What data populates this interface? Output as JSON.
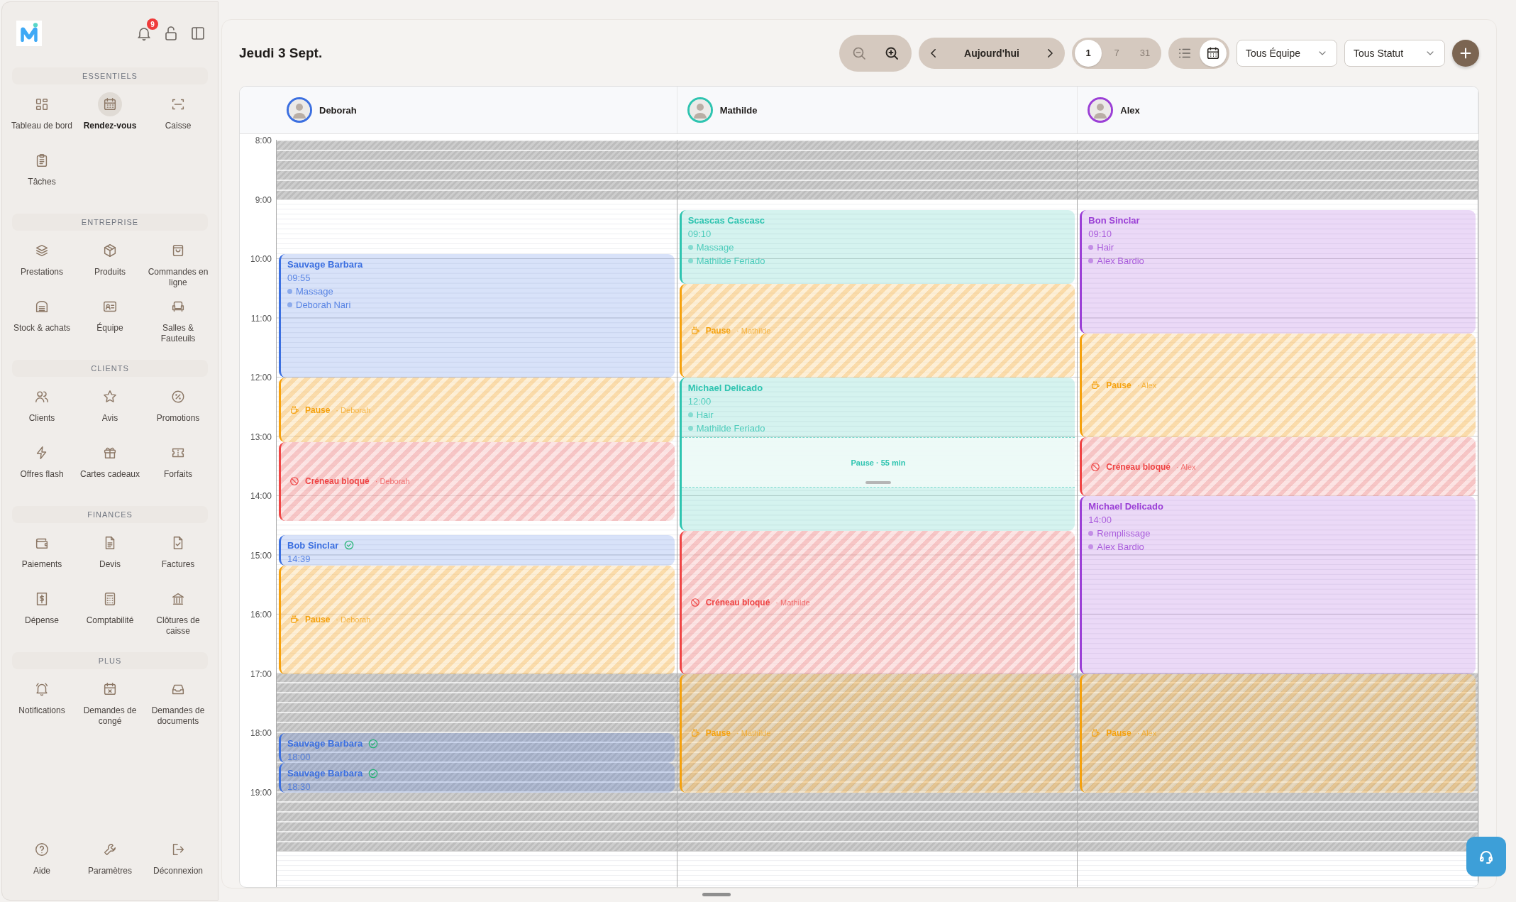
{
  "sidebar": {
    "notification_count": "9",
    "sections": [
      {
        "title": "ESSENTIELS",
        "items": [
          {
            "label": "Tableau de bord",
            "selected": false
          },
          {
            "label": "Rendez-vous",
            "selected": true
          },
          {
            "label": "Caisse",
            "selected": false
          },
          {
            "label": "Tâches",
            "selected": false
          }
        ]
      },
      {
        "title": "ENTREPRISE",
        "items": [
          {
            "label": "Prestations",
            "selected": false
          },
          {
            "label": "Produits",
            "selected": false
          },
          {
            "label": "Commandes en ligne",
            "selected": false
          },
          {
            "label": "Stock & achats",
            "selected": false
          },
          {
            "label": "Équipe",
            "selected": false
          },
          {
            "label": "Salles & Fauteuils",
            "selected": false
          }
        ]
      },
      {
        "title": "CLIENTS",
        "items": [
          {
            "label": "Clients",
            "selected": false
          },
          {
            "label": "Avis",
            "selected": false
          },
          {
            "label": "Promotions",
            "selected": false
          },
          {
            "label": "Offres flash",
            "selected": false
          },
          {
            "label": "Cartes cadeaux",
            "selected": false
          },
          {
            "label": "Forfaits",
            "selected": false
          }
        ]
      },
      {
        "title": "FINANCES",
        "items": [
          {
            "label": "Paiements",
            "selected": false
          },
          {
            "label": "Devis",
            "selected": false
          },
          {
            "label": "Factures",
            "selected": false
          },
          {
            "label": "Dépense",
            "selected": false
          },
          {
            "label": "Comptabilité",
            "selected": false
          },
          {
            "label": "Clôtures de caisse",
            "selected": false
          }
        ]
      },
      {
        "title": "PLUS",
        "items": [
          {
            "label": "Notifications",
            "selected": false
          },
          {
            "label": "Demandes de congé",
            "selected": false
          },
          {
            "label": "Demandes de documents",
            "selected": false
          }
        ]
      }
    ],
    "footer": [
      {
        "label": "Aide"
      },
      {
        "label": "Paramètres"
      },
      {
        "label": "Déconnexion"
      }
    ]
  },
  "header": {
    "title": "Jeudi 3 Sept.",
    "today": "Aujourd'hui",
    "views": [
      {
        "label": "1",
        "selected": true
      },
      {
        "label": "7",
        "selected": false
      },
      {
        "label": "31",
        "selected": false
      }
    ],
    "display_modes": [
      {
        "selected": false
      },
      {
        "selected": true
      }
    ],
    "filters": [
      {
        "value": "Tous Équipe"
      },
      {
        "value": "Tous Statut"
      }
    ]
  },
  "calendar": {
    "hours": [
      "8:00",
      "9:00",
      "10:00",
      "11:00",
      "12:00",
      "13:00",
      "14:00",
      "15:00",
      "16:00",
      "17:00",
      "18:00",
      "19:00"
    ],
    "staff": [
      {
        "name": "Deborah",
        "color": "#3b6fe0",
        "events": [
          {
            "kind": "appointment",
            "client": "Sauvage Barbara",
            "time": "09:55",
            "details": [
              "Massage",
              "Deborah Nari"
            ],
            "confirmed": false
          },
          {
            "kind": "pause",
            "label": "Pause",
            "owner": "· Deborah"
          },
          {
            "kind": "blocked",
            "label": "Créneau bloqué",
            "owner": "· Deborah"
          },
          {
            "kind": "appointment",
            "client": "Bob Sinclar",
            "time": "14:39",
            "confirmed": true
          },
          {
            "kind": "pause",
            "label": "Pause",
            "owner": "· Deborah"
          },
          {
            "kind": "appointment",
            "client": "Sauvage Barbara",
            "time": "18:00",
            "confirmed": true
          },
          {
            "kind": "appointment",
            "client": "Sauvage Barbara",
            "time": "18:30",
            "confirmed": true
          }
        ]
      },
      {
        "name": "Mathilde",
        "color": "#2ec4b0",
        "events": [
          {
            "kind": "appointment",
            "client": "Scascas Cascasc",
            "time": "09:10",
            "details": [
              "Massage",
              "Mathilde Feriado"
            ],
            "confirmed": false
          },
          {
            "kind": "pause",
            "label": "Pause",
            "owner": "· Mathilde"
          },
          {
            "kind": "appointment",
            "client": "Michael Delicado",
            "time": "12:00",
            "details": [
              "Hair",
              "Mathilde Feriado"
            ],
            "confirmed": false,
            "gap": {
              "label": "Pause · 55 min"
            }
          },
          {
            "kind": "blocked",
            "label": "Créneau bloqué",
            "owner": "· Mathilde"
          },
          {
            "kind": "pause",
            "label": "Pause",
            "owner": "· Mathilde"
          }
        ]
      },
      {
        "name": "Alex",
        "color": "#9b3fd6",
        "events": [
          {
            "kind": "appointment",
            "client": "Bon Sinclar",
            "time": "09:10",
            "details": [
              "Hair",
              "Alex Bardio"
            ],
            "confirmed": false
          },
          {
            "kind": "pause",
            "label": "Pause",
            "owner": "· Alex"
          },
          {
            "kind": "blocked",
            "label": "Créneau bloqué",
            "owner": "· Alex"
          },
          {
            "kind": "appointment",
            "client": "Michael Delicado",
            "time": "14:00",
            "details": [
              "Remplissage",
              "Alex Bardio"
            ],
            "confirmed": false
          },
          {
            "kind": "pause",
            "label": "Pause",
            "owner": "· Alex"
          }
        ]
      }
    ]
  }
}
